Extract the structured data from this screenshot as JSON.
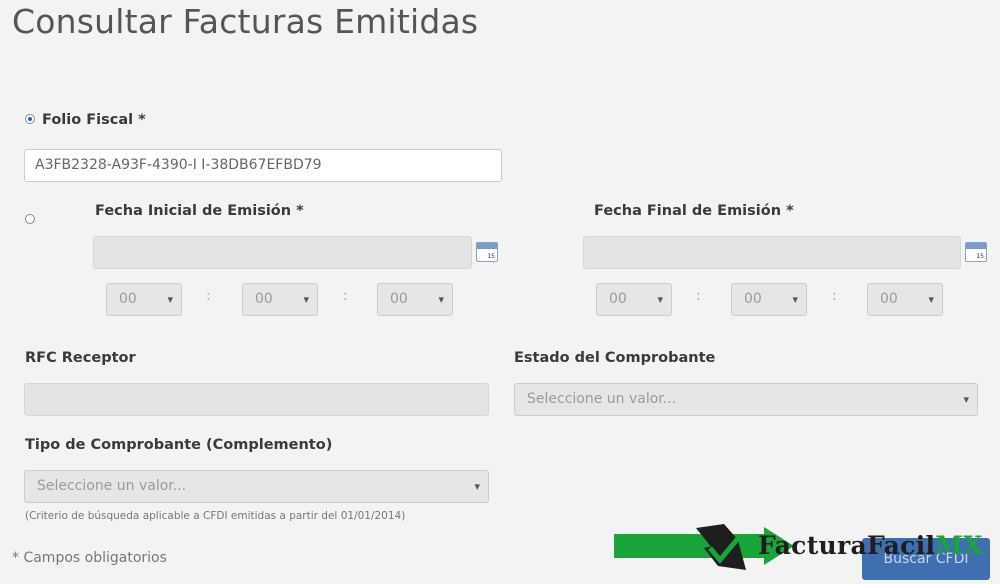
{
  "page": {
    "title": "Consultar Facturas Emitidas"
  },
  "folio": {
    "label": "Folio Fiscal *",
    "value": "A3FB2328-A93F-4390-I        I-38DB67EFBD79"
  },
  "fecha_inicial": {
    "label": "Fecha Inicial de Emisión *",
    "hour": "00",
    "minute": "00",
    "second": "00"
  },
  "fecha_final": {
    "label": "Fecha Final de Emisión *",
    "hour": "00",
    "minute": "00",
    "second": "00"
  },
  "time_separator": ":",
  "calendar_text": "15",
  "rfc": {
    "label": "RFC Receptor",
    "value": ""
  },
  "estado": {
    "label": "Estado del Comprobante",
    "selected": "Seleccione un valor..."
  },
  "tipo": {
    "label": "Tipo de Comprobante (Complemento)",
    "selected": "Seleccione un valor...",
    "hint": "(Criterio de búsqueda aplicable a CFDI emitidas a partir del 01/01/2014)"
  },
  "required_note": "* Campos obligatorios",
  "search_button": "Buscar CFDI",
  "watermark": {
    "brand": "FacturaFacil",
    "suffix": "MX"
  },
  "colors": {
    "accent": "#3f6fb0",
    "brand_green": "#18a63a"
  }
}
